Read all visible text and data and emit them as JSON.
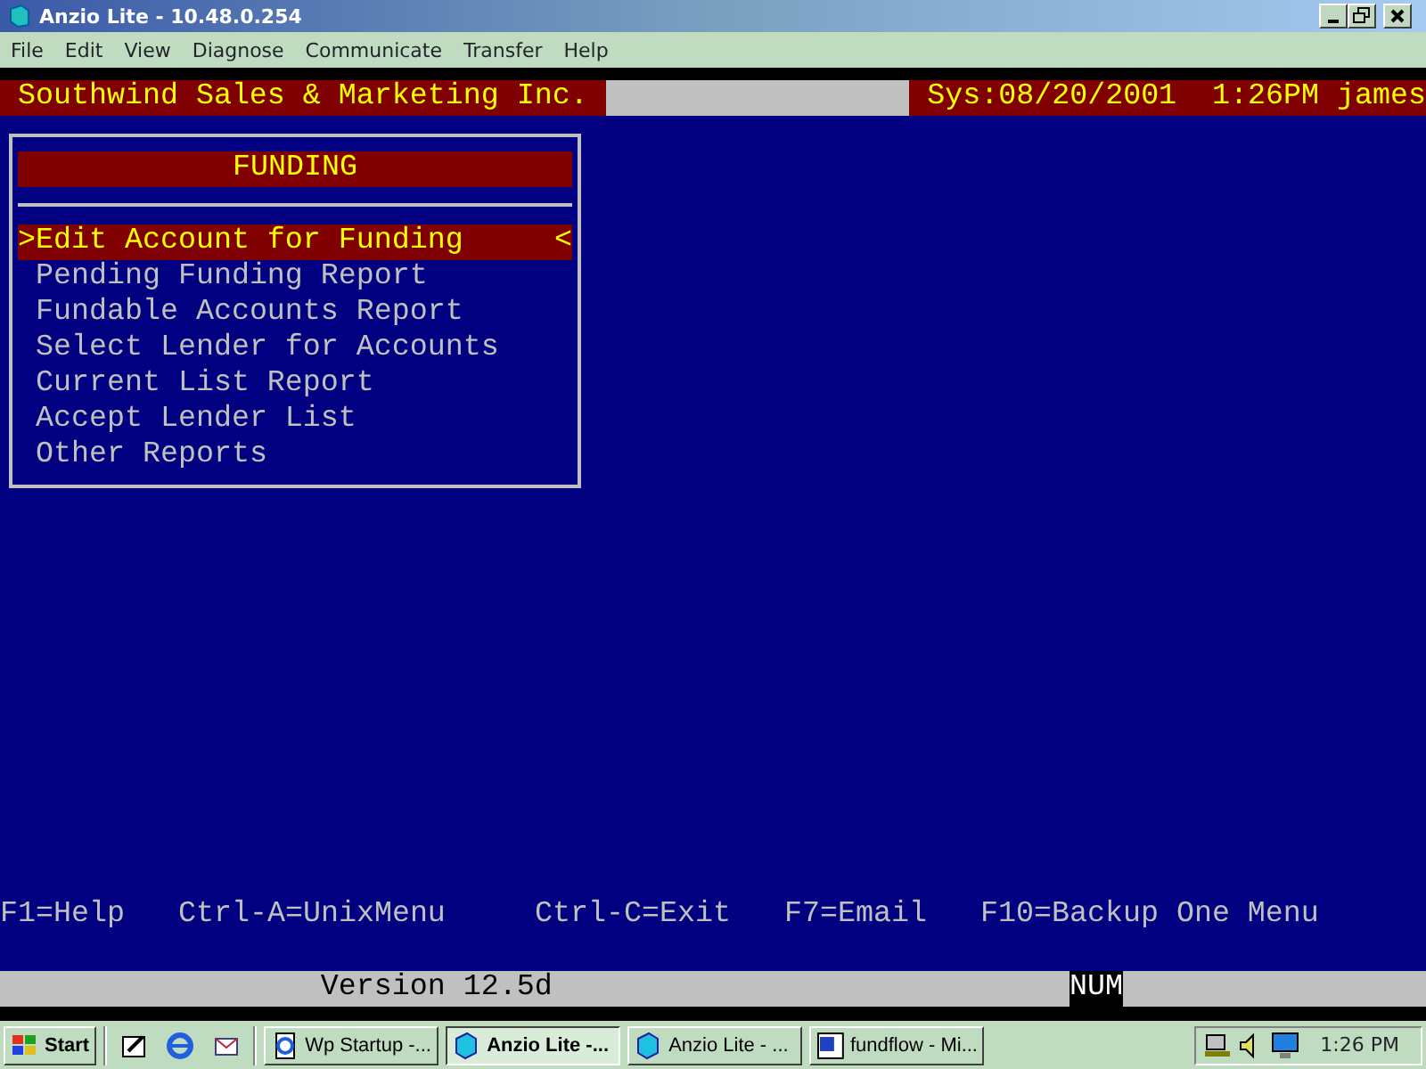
{
  "window": {
    "title": "Anzio Lite -  10.48.0.254"
  },
  "menu_bar": [
    "File",
    "Edit",
    "View",
    "Diagnose",
    "Communicate",
    "Transfer",
    "Help"
  ],
  "terminal": {
    "company": "Southwind Sales & Marketing Inc.",
    "system_info": "Sys:08/20/2001  1:26PM james",
    "menu": {
      "title": "FUNDING",
      "left_marker": ">",
      "right_marker": "<",
      "items": [
        {
          "label": "Edit Account for Funding",
          "selected": true
        },
        {
          "label": "Pending Funding Report",
          "selected": false
        },
        {
          "label": "Fundable Accounts Report",
          "selected": false
        },
        {
          "label": "Select Lender for Accounts",
          "selected": false
        },
        {
          "label": "Current List Report",
          "selected": false
        },
        {
          "label": "Accept Lender List",
          "selected": false
        },
        {
          "label": "Other Reports",
          "selected": false
        }
      ]
    },
    "function_keys": [
      "F1=Help",
      "Ctrl-A=UnixMenu",
      "Ctrl-C=Exit",
      "F7=Email",
      "F10=Backup One Menu"
    ]
  },
  "status_bar": {
    "version": "Version 12.5d",
    "num_lock": "NUM"
  },
  "taskbar": {
    "start": "Start",
    "tasks": [
      {
        "label": "Wp Startup -...",
        "kind": "doc",
        "selected": false
      },
      {
        "label": "Anzio Lite -...",
        "kind": "anzio",
        "selected": true
      },
      {
        "label": "Anzio Lite -  ...",
        "kind": "anzio",
        "selected": false
      },
      {
        "label": "fundflow - Mi...",
        "kind": "word",
        "selected": false
      }
    ],
    "clock": "1:26 PM"
  }
}
